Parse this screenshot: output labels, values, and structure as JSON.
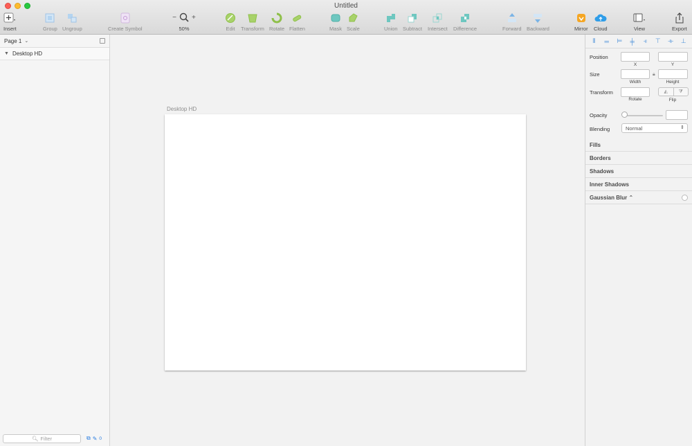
{
  "window": {
    "title": "Untitled"
  },
  "toolbar": {
    "insert": "Insert",
    "group": "Group",
    "ungroup": "Ungroup",
    "create_symbol": "Create Symbol",
    "zoom_minus": "−",
    "zoom_plus": "+",
    "zoom_level": "50%",
    "edit": "Edit",
    "transform": "Transform",
    "rotate": "Rotate",
    "flatten": "Flatten",
    "mask": "Mask",
    "scale": "Scale",
    "union": "Union",
    "subtract": "Subtract",
    "intersect": "Intersect",
    "difference": "Difference",
    "forward": "Forward",
    "backward": "Backward",
    "mirror": "Mirror",
    "cloud": "Cloud",
    "view": "View",
    "export": "Export"
  },
  "layers": {
    "page": "Page 1",
    "items": [
      {
        "name": "Desktop HD"
      }
    ],
    "filter_placeholder": "Filter",
    "artboard_count": "0"
  },
  "canvas": {
    "artboard_title": "Desktop HD"
  },
  "inspector": {
    "position_label": "Position",
    "x_label": "X",
    "y_label": "Y",
    "size_label": "Size",
    "width_label": "Width",
    "height_label": "Height",
    "transform_label": "Transform",
    "rotate_label": "Rotate",
    "flip_label": "Flip",
    "opacity_label": "Opacity",
    "blending_label": "Blending",
    "blending_value": "Normal",
    "sections": [
      "Fills",
      "Borders",
      "Shadows",
      "Inner Shadows",
      "Gaussian Blur ⌃"
    ]
  },
  "colors": {
    "accent": "#4a90d9",
    "toolbar_green": "#8fc04a",
    "toolbar_teal": "#6ec7c0",
    "mirror_orange": "#f5a623",
    "cloud_blue": "#2f9de8"
  }
}
